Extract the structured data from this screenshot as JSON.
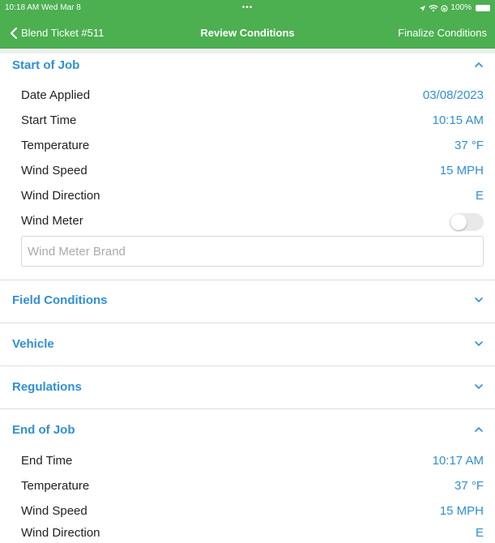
{
  "status": {
    "time": "10:18 AM  Wed Mar 8",
    "dots": "•••",
    "battery_text": "100%"
  },
  "nav": {
    "back_label": "Blend Ticket #511",
    "title": "Review Conditions",
    "right_label": "Finalize Conditions"
  },
  "sections": {
    "start": {
      "title": "Start of Job",
      "rows": [
        {
          "label": "Date Applied",
          "value": "03/08/2023"
        },
        {
          "label": "Start Time",
          "value": "10:15 AM"
        },
        {
          "label": "Temperature",
          "value": "37 °F"
        },
        {
          "label": "Wind Speed",
          "value": "15 MPH"
        },
        {
          "label": "Wind Direction",
          "value": "E"
        }
      ],
      "wind_meter_label": "Wind Meter",
      "wind_meter_on": false,
      "wind_meter_brand_placeholder": "Wind Meter Brand"
    },
    "field": {
      "title": "Field Conditions"
    },
    "vehicle": {
      "title": "Vehicle"
    },
    "regulations": {
      "title": "Regulations"
    },
    "end": {
      "title": "End of Job",
      "rows": [
        {
          "label": "End Time",
          "value": "10:17 AM"
        },
        {
          "label": "Temperature",
          "value": "37 °F"
        },
        {
          "label": "Wind Speed",
          "value": "15 MPH"
        },
        {
          "label": "Wind Direction",
          "value": "E"
        }
      ]
    }
  },
  "colors": {
    "header_green": "#4caf50",
    "accent_blue": "#2f8fd8"
  }
}
